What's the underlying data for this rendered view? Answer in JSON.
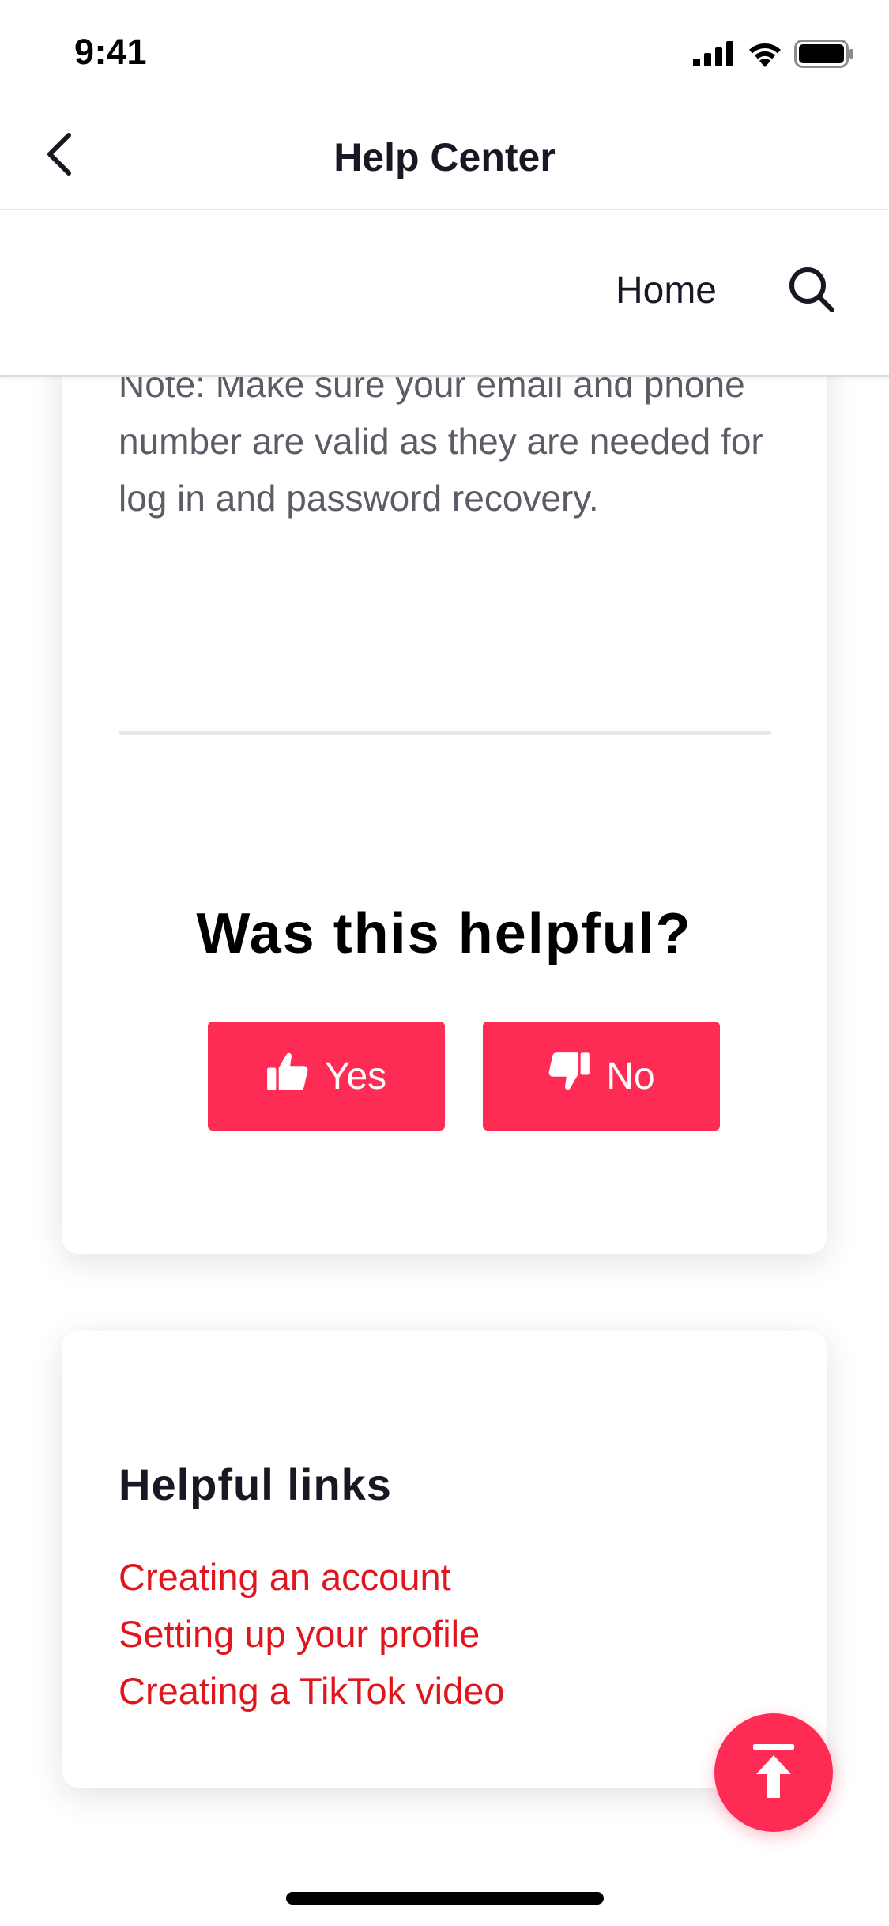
{
  "status_bar": {
    "time": "9:41"
  },
  "nav": {
    "title": "Help Center"
  },
  "sub_header": {
    "home_label": "Home"
  },
  "article": {
    "note_text": "Note: Make sure your email and phone number are valid as they are needed for log in and password recovery.",
    "feedback": {
      "question": "Was this helpful?",
      "yes_label": "Yes",
      "no_label": "No"
    }
  },
  "helpful_links": {
    "title": "Helpful links",
    "items": [
      "Creating an account",
      "Setting up your profile",
      "Creating a TikTok video"
    ]
  },
  "colors": {
    "accent": "#fe2c55",
    "link": "#e1151c",
    "text": "#161823",
    "muted_text": "#5a5c66"
  },
  "icons": {
    "back": "chevron-left-icon",
    "search": "search-icon",
    "yes": "thumbs-up-icon",
    "no": "thumbs-down-icon",
    "to_top": "arrow-up-to-line-icon"
  }
}
